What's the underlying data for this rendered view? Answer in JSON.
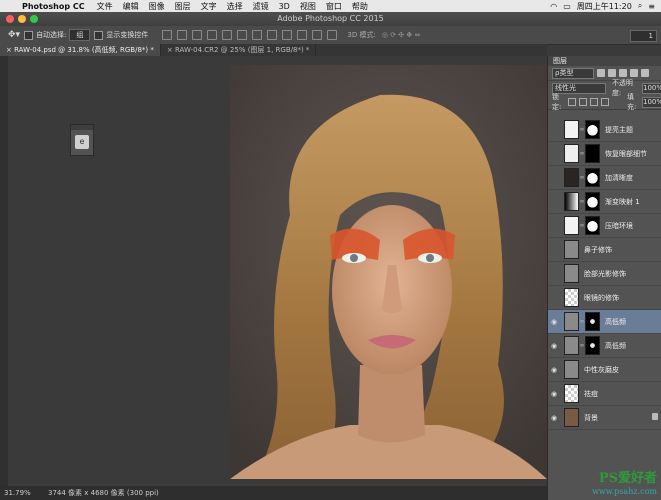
{
  "menubar": {
    "app": "Photoshop CC",
    "items": [
      "文件",
      "编辑",
      "图像",
      "图层",
      "文字",
      "选择",
      "滤镜",
      "3D",
      "视图",
      "窗口",
      "帮助"
    ],
    "clock": "周四上午11:20"
  },
  "window": {
    "title": "Adobe Photoshop CC 2015"
  },
  "options": {
    "auto_select_label": "自动选择:",
    "auto_select_value": "组",
    "show_transform_label": "显示变换控件",
    "mode3d_label": "3D 模式:",
    "right_value": "1"
  },
  "tabs": [
    {
      "label": "RAW-04.psd @ 31.8% (高低频, RGB/8*) *"
    },
    {
      "label": "RAW-04.CR2 @ 25% (图层 1, RGB/8*) *"
    }
  ],
  "status": {
    "zoom": "31.79%",
    "doc": "3744 像素 x 4680 像素 (300 ppi)"
  },
  "layers_panel": {
    "tab": "图层",
    "kind": "ρ类型",
    "blend_mode": "线性光",
    "opacity_label": "不透明度:",
    "opacity": "100%",
    "lock_label": "锁定:",
    "fill_label": "填充:",
    "fill": "100%",
    "layers": [
      {
        "name": "提亮主题",
        "visible": false,
        "thumb": "curves",
        "mask": "white-shape"
      },
      {
        "name": "恢复眼部细节",
        "visible": false,
        "thumb": "levels",
        "mask": "black"
      },
      {
        "name": "加清晰度",
        "visible": false,
        "thumb": "photo-dark",
        "mask": "white-shape"
      },
      {
        "name": "渐变映射 1",
        "visible": false,
        "thumb": "gradient",
        "mask": "white-shape"
      },
      {
        "name": "压暗环境",
        "visible": false,
        "thumb": "curves",
        "mask": "white-shape"
      },
      {
        "name": "鼻子修饰",
        "visible": false,
        "thumb": "gray",
        "mask": ""
      },
      {
        "name": "脸部光影修饰",
        "visible": false,
        "thumb": "gray",
        "mask": ""
      },
      {
        "name": "眼镜的修饰",
        "visible": false,
        "thumb": "checker",
        "mask": ""
      },
      {
        "name": "高低频",
        "visible": true,
        "selected": true,
        "thumb": "gray",
        "mask": "black-face"
      },
      {
        "name": "高低频",
        "visible": true,
        "thumb": "gray",
        "mask": "black-face"
      },
      {
        "name": "中性灰磨皮",
        "visible": true,
        "thumb": "gray",
        "mask": ""
      },
      {
        "name": "祛痘",
        "visible": true,
        "thumb": "checker",
        "mask": ""
      },
      {
        "name": "背景",
        "visible": true,
        "thumb": "photo",
        "mask": "",
        "locked": true
      }
    ]
  },
  "watermark": {
    "line1": "PS爱好者",
    "line2": "www.psahz.com"
  }
}
